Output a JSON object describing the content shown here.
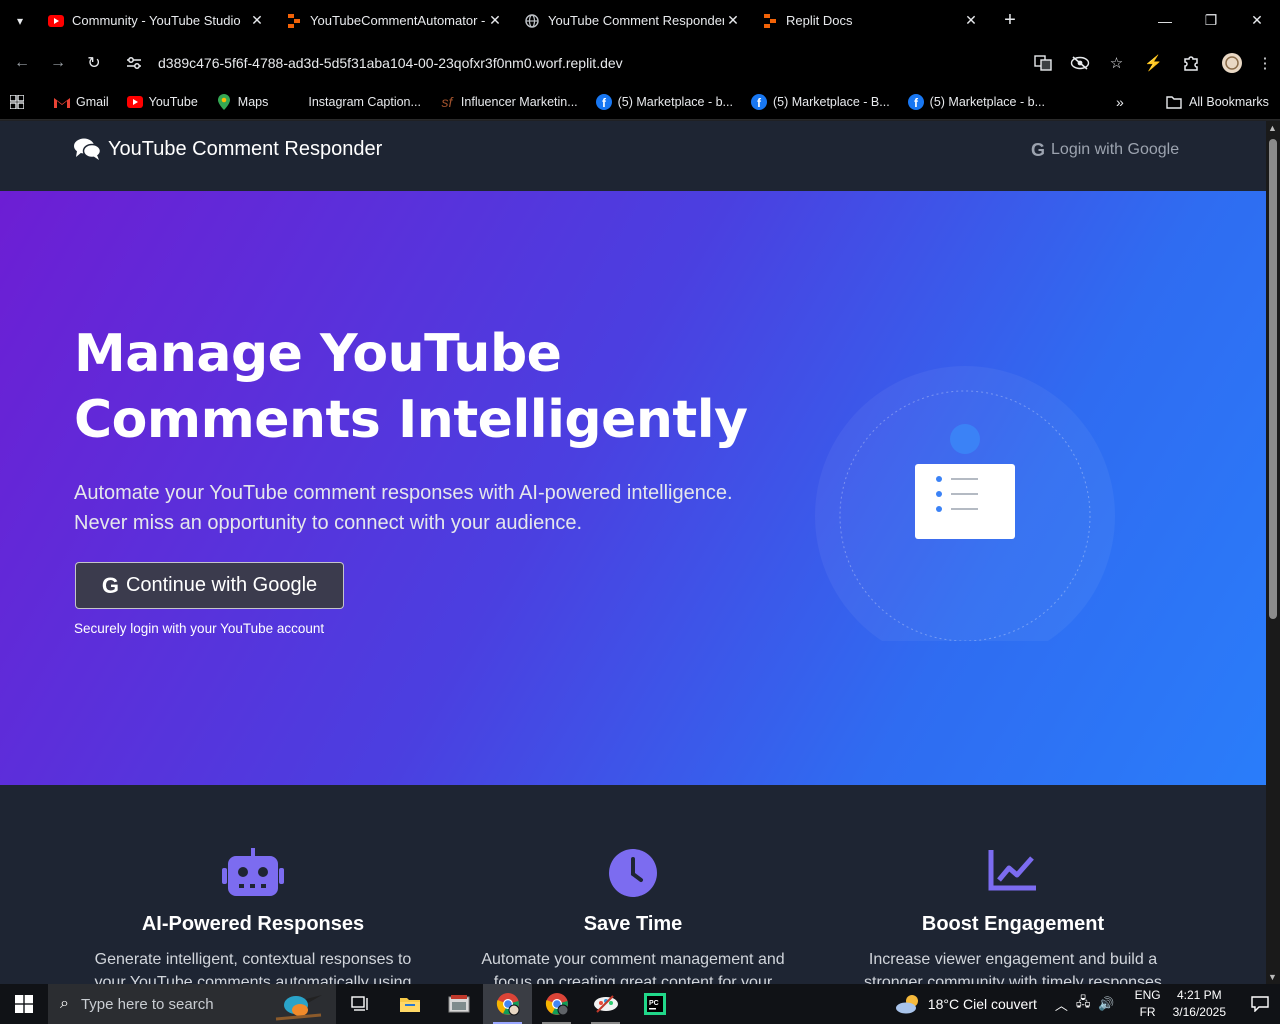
{
  "browser": {
    "tabs": [
      {
        "title": "Community - YouTube Studio",
        "icon": "youtube-icon",
        "active": false
      },
      {
        "title": "YouTubeCommentAutomator - ",
        "icon": "replit-icon",
        "active": false
      },
      {
        "title": "YouTube Comment Responder",
        "icon": "globe-icon",
        "active": true
      },
      {
        "title": "Replit Docs",
        "icon": "replit-icon",
        "active": false
      }
    ],
    "url": "d389c476-5f6f-4788-ad3d-5d5f31aba104-00-23qofxr3f0nm0.worf.replit.dev",
    "bookmarks": [
      {
        "label": "Gmail",
        "icon": "gmail-icon"
      },
      {
        "label": "YouTube",
        "icon": "youtube-icon"
      },
      {
        "label": "Maps",
        "icon": "maps-icon"
      },
      {
        "label": "Instagram Caption...",
        "icon": "blank-icon"
      },
      {
        "label": "Influencer Marketin...",
        "icon": "sf-icon"
      },
      {
        "label": "(5) Marketplace - b...",
        "icon": "facebook-icon"
      },
      {
        "label": "(5) Marketplace - B...",
        "icon": "facebook-icon"
      },
      {
        "label": "(5) Marketplace - b...",
        "icon": "facebook-icon"
      }
    ],
    "all_bookmarks": "All Bookmarks"
  },
  "site": {
    "brand": "YouTube Comment Responder",
    "login_label": "Login with Google",
    "hero": {
      "title_line1": "Manage YouTube",
      "title_line2": "Comments Intelligently",
      "subtitle": "Automate your YouTube comment responses with AI-powered intelligence. Never miss an opportunity to connect with your audience.",
      "cta_label": "Continue with Google",
      "note": "Securely login with your YouTube account"
    },
    "features": [
      {
        "icon": "robot-icon",
        "title": "AI-Powered Responses",
        "desc": "Generate intelligent, contextual responses to your YouTube comments automatically using"
      },
      {
        "icon": "clock-icon",
        "title": "Save Time",
        "desc": "Automate your comment management and focus on creating great content for your"
      },
      {
        "icon": "chart-line-icon",
        "title": "Boost Engagement",
        "desc": "Increase viewer engagement and build a stronger community with timely responses"
      }
    ],
    "accent_color": "#6c63ff"
  },
  "taskbar": {
    "search_placeholder": "Type here to search",
    "weather": "18°C  Ciel couvert",
    "lang_top": "ENG",
    "lang_bottom": "FR",
    "time": "4:21 PM",
    "date": "3/16/2025"
  }
}
